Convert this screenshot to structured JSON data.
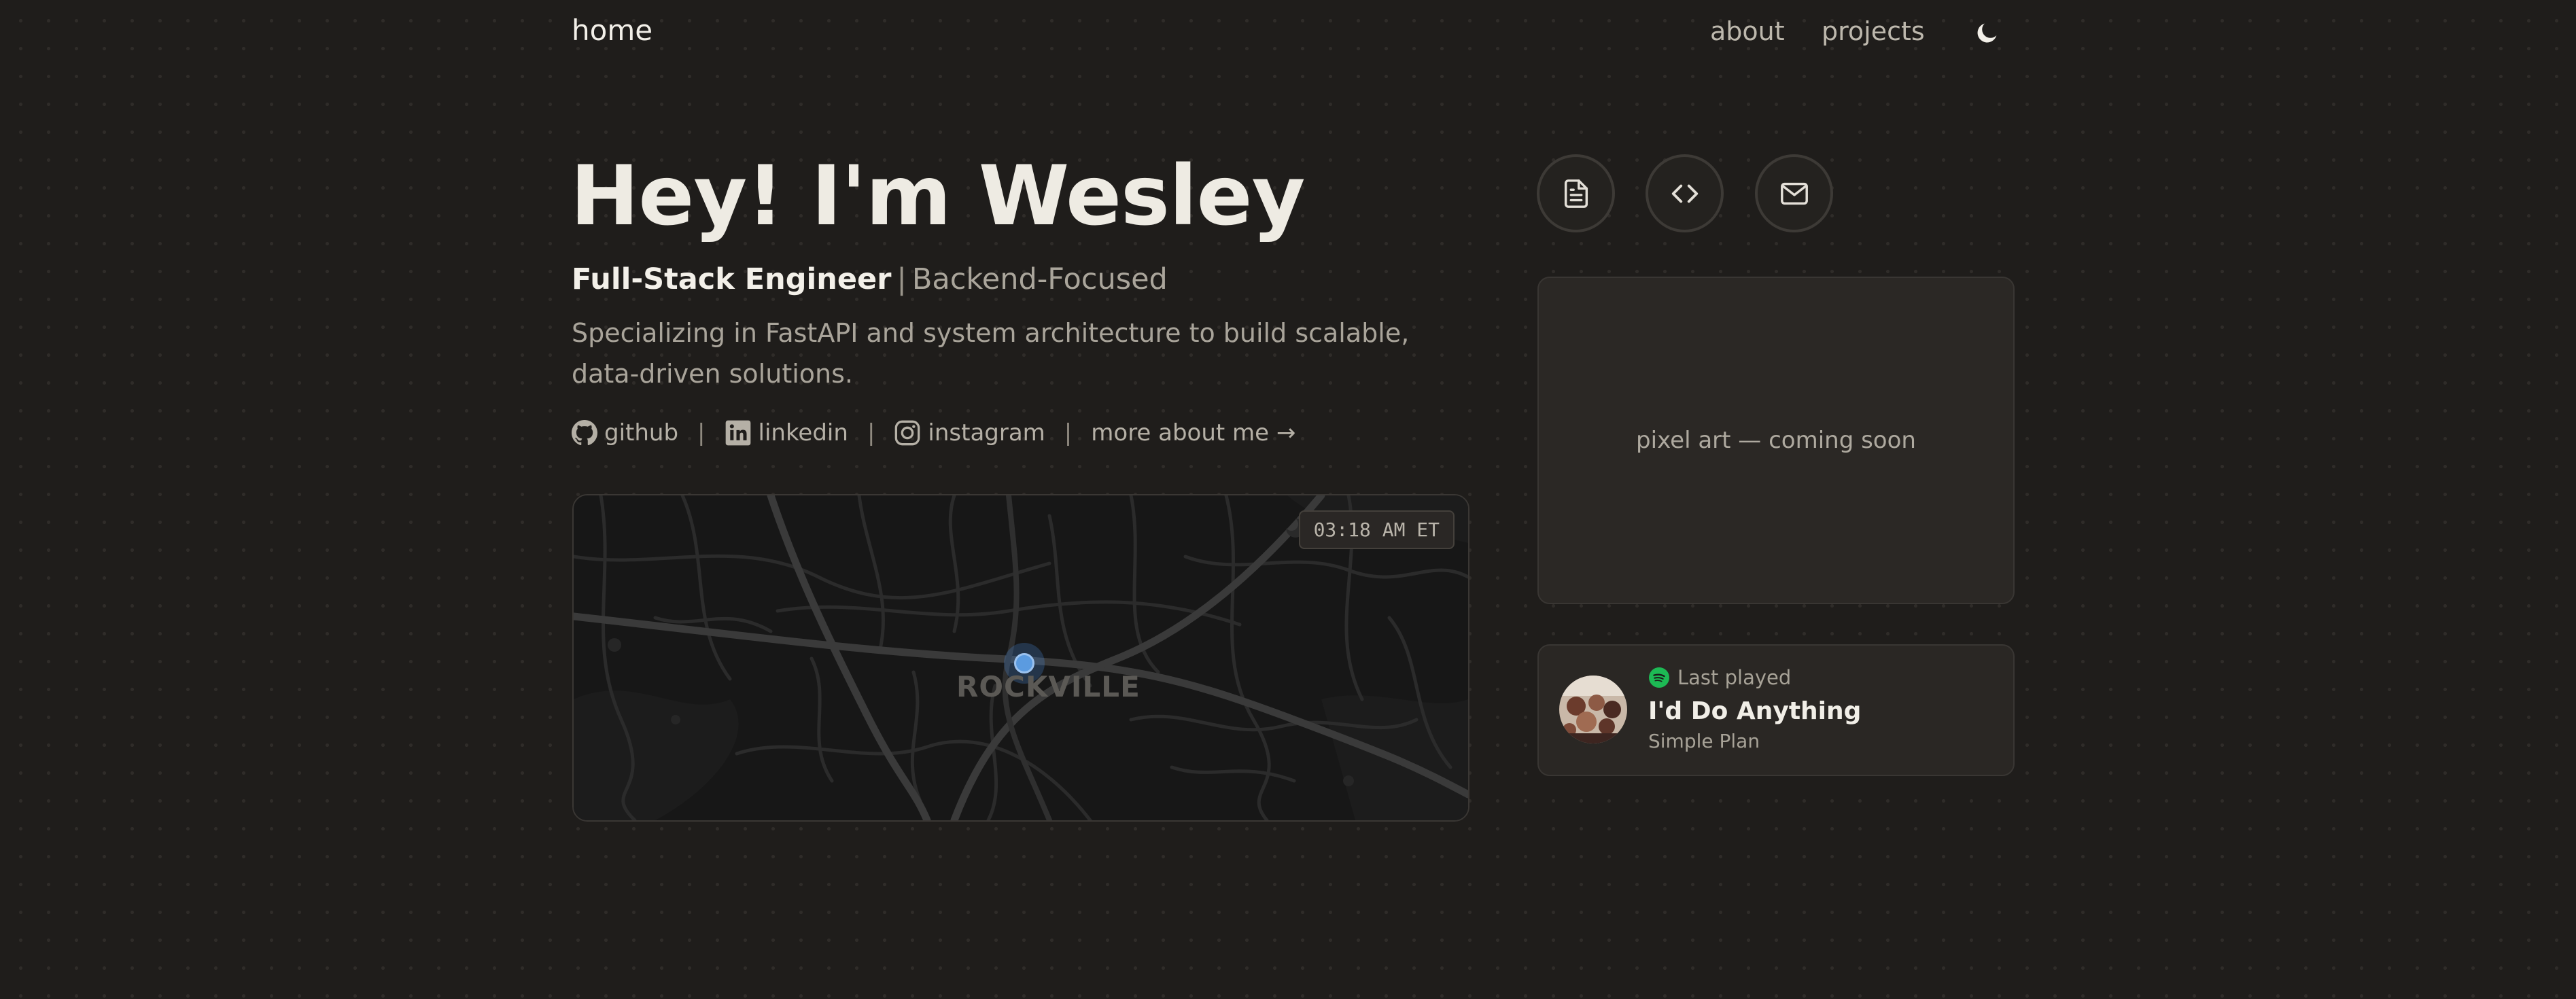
{
  "nav": {
    "home_label": "home",
    "links": [
      {
        "label": "about"
      },
      {
        "label": "projects"
      }
    ],
    "theme_icon": "moon-icon"
  },
  "hero": {
    "title": "Hey! I'm Wesley",
    "role_primary": "Full-Stack Engineer",
    "role_separator": "|",
    "role_secondary": "Backend-Focused",
    "tagline": "Specializing in FastAPI and system architecture to build scalable, data-driven solutions."
  },
  "socials": {
    "items": [
      {
        "label": "github",
        "icon": "github-icon"
      },
      {
        "label": "linkedin",
        "icon": "linkedin-icon"
      },
      {
        "label": "instagram",
        "icon": "instagram-icon"
      }
    ],
    "separator": "|",
    "more_link": "more about me →"
  },
  "map": {
    "city": "ROCKVILLE",
    "time": "03:18 AM ET"
  },
  "quick_links": [
    {
      "icon": "document-icon"
    },
    {
      "icon": "code-icon"
    },
    {
      "icon": "mail-icon"
    }
  ],
  "pixel_art": {
    "text": "pixel art — coming soon"
  },
  "now_playing": {
    "status": "Last played",
    "track": "I'd Do Anything",
    "artist": "Simple Plan",
    "service_icon": "spotify-icon"
  },
  "colors": {
    "background": "#1f1d1b",
    "card": "#2b2825",
    "accent_pin": "#5b9be0",
    "spotify_green": "#1db954",
    "text_primary": "#eeebe3",
    "text_muted": "#a9a49a"
  }
}
